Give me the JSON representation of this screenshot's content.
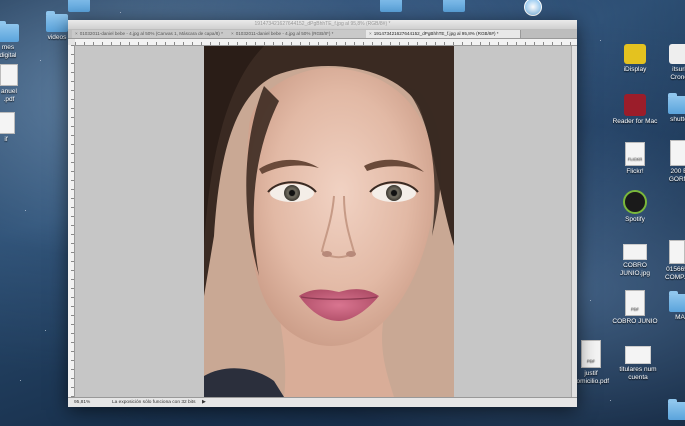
{
  "desktop": {
    "left_icons": [
      {
        "label": "mes\ndigital"
      },
      {
        "label": "videos"
      },
      {
        "label": "anuel\n.pdf"
      },
      {
        "label": "if"
      }
    ],
    "right_icons": [
      {
        "label": "iDisplay",
        "icon": "idisplay-icon"
      },
      {
        "label": "itsuri\nCronc",
        "icon": "app-icon"
      },
      {
        "label": "Reader for Mac",
        "icon": "reader-icon"
      },
      {
        "label": "shutte",
        "icon": "folder-icon"
      },
      {
        "label": "Flickr!",
        "icon": "flickr-icon"
      },
      {
        "label": "200 E\nGORM",
        "icon": "document-icon"
      },
      {
        "label": "Spotify",
        "icon": "spotify-icon"
      },
      {
        "label": "COBRO\nJUNIO.jpg",
        "icon": "image-icon"
      },
      {
        "label": "015665\nCOMP...",
        "icon": "document-icon"
      },
      {
        "label": "COBRO JUNIO",
        "icon": "pdf-icon"
      },
      {
        "label": "MA",
        "icon": "folder-icon"
      },
      {
        "label": "justif\ndomicilio.pdf",
        "icon": "pdf-icon"
      },
      {
        "label": "titulares num\ncuenta",
        "icon": "image-icon"
      }
    ]
  },
  "window": {
    "title": "191473421627644152_dPgBhhTE_f.jpg al 95,8% (RGB/8#) *",
    "tabs": [
      {
        "label": "01032011-daniel bebe - 4.jpg al 50% (Canvas 1, Máscara de capa/8) *"
      },
      {
        "label": "01032011-daniel bebe - 4.jpg al 50% (RGB/8*) *"
      },
      {
        "label": "191473421627644152_dPgBhhTE_f.jpg al 95,8% (RGB/8#) *"
      }
    ],
    "status": {
      "zoom": "95,81%",
      "message": "La exposición sólo funciona con 32 bits"
    }
  }
}
